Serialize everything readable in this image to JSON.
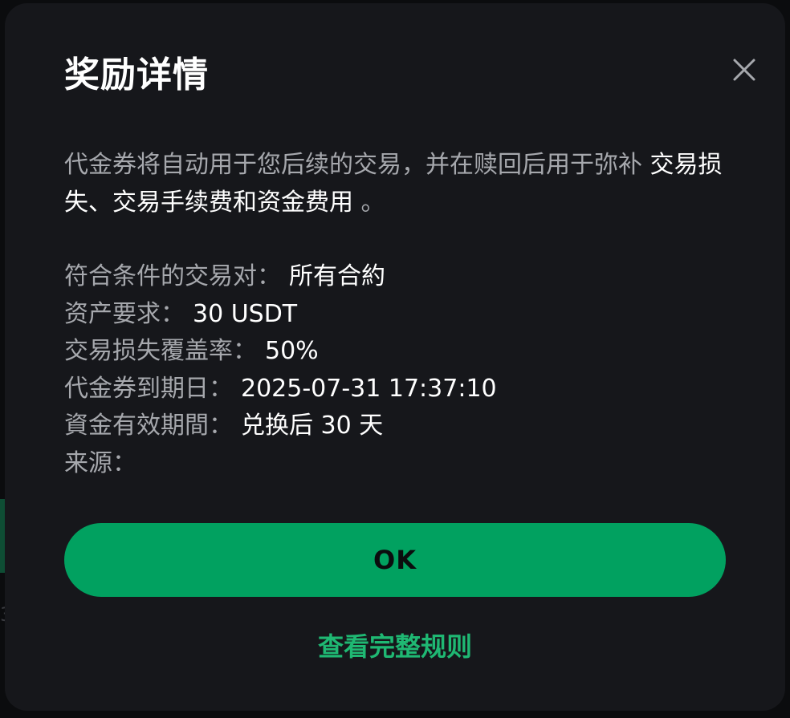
{
  "modal": {
    "title": "奖励详情",
    "close_icon": "close-icon",
    "description_prefix": "代金券将自动用于您后续的交易，并在赎回后用于弥补 ",
    "description_highlight": "交易损失、交易手续费和资金费用",
    "description_suffix": " 。",
    "details": [
      {
        "label": "符合条件的交易对：",
        "value": "所有合約"
      },
      {
        "label": "资产要求：",
        "value": "30 USDT"
      },
      {
        "label": "交易损失覆盖率：",
        "value": "50%"
      },
      {
        "label": "代金券到期日：",
        "value": "2025-07-31 17:37:10"
      },
      {
        "label": "資金有效期間：",
        "value": "兑换后 30 天"
      },
      {
        "label": "来源：",
        "value": ""
      }
    ],
    "ok_label": "OK",
    "rules_link": "查看完整规则"
  },
  "background": {
    "edge_glyph": "3"
  },
  "colors": {
    "accent": "#01a160",
    "link": "#1fb873",
    "modal_bg": "#16171b",
    "muted_text": "#a6a8ad"
  }
}
